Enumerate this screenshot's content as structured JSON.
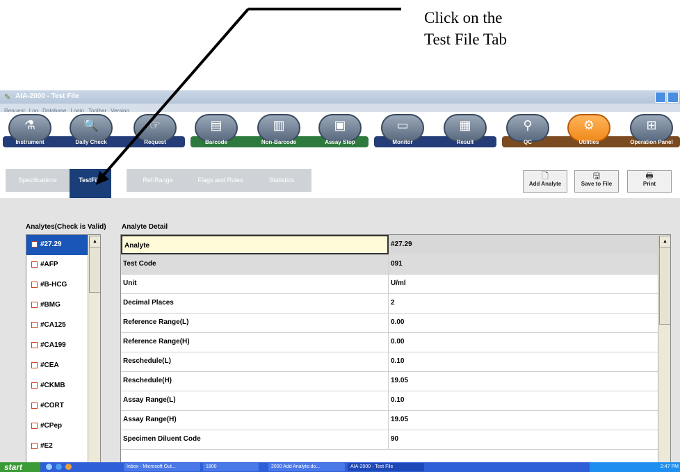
{
  "annotation": {
    "line1": "Click on the",
    "line2": "Test File Tab"
  },
  "window": {
    "title": "AIA-2000 - Test File"
  },
  "menu": [
    "Request",
    "Log",
    "Database",
    "Login",
    "Toolbar",
    "Version"
  ],
  "toolbar": [
    {
      "label": "Instrument",
      "icon": "instrument-icon",
      "glyph": "⚗"
    },
    {
      "label": "Daily Check",
      "icon": "magnifier-document-icon",
      "glyph": "🔍"
    },
    {
      "label": "Request",
      "icon": "request-icon",
      "glyph": "☞"
    },
    {
      "label": "Barcode",
      "icon": "barcode-icon",
      "glyph": "▤"
    },
    {
      "label": "Non-Barcode",
      "icon": "non-barcode-icon",
      "glyph": "▥"
    },
    {
      "label": "Assay Stop",
      "icon": "assay-stop-icon",
      "glyph": "▣"
    },
    {
      "label": "Monitor",
      "icon": "monitor-icon",
      "glyph": "▭"
    },
    {
      "label": "Result",
      "icon": "result-icon",
      "glyph": "▦"
    },
    {
      "label": "QC",
      "icon": "qc-icon",
      "glyph": "⚲"
    },
    {
      "label": "Utilities",
      "icon": "gears-icon",
      "glyph": "⚙"
    },
    {
      "label": "Operation Panel",
      "icon": "operation-panel-icon",
      "glyph": "⊞"
    }
  ],
  "tabs": [
    "Specifications",
    "TestFile",
    "Ref.Range",
    "Flags and Rules",
    "Statistics"
  ],
  "active_tab": "TestFile",
  "actions": [
    {
      "label": "Add Analyte",
      "icon": "document-icon",
      "glyph": "🗋"
    },
    {
      "label": "Save to File",
      "icon": "floppy-disk-icon",
      "glyph": "🖫"
    },
    {
      "label": "Print",
      "icon": "printer-icon",
      "glyph": "🖶"
    }
  ],
  "analytes_label": "Analytes(Check is Valid)",
  "detail_label": "Analyte Detail",
  "analytes": [
    "#27.29",
    "#AFP",
    "#B-HCG",
    "#BMG",
    "#CA125",
    "#CA199",
    "#CEA",
    "#CKMB",
    "#CORT",
    "#CPep",
    "#E2"
  ],
  "selected_analyte": "#27.29",
  "detail_rows": [
    {
      "field": "Analyte",
      "value": "#27.29"
    },
    {
      "field": "Test Code",
      "value": "091"
    },
    {
      "field": "Unit",
      "value": "U/ml"
    },
    {
      "field": "Decimal Places",
      "value": "2"
    },
    {
      "field": "Reference Range(L)",
      "value": "0.00"
    },
    {
      "field": "Reference Range(H)",
      "value": "0.00"
    },
    {
      "field": "Reschedule(L)",
      "value": "0.10"
    },
    {
      "field": "Reschedule(H)",
      "value": "19.05"
    },
    {
      "field": "Assay Range(L)",
      "value": "0.10"
    },
    {
      "field": "Assay Range(H)",
      "value": "19.05"
    },
    {
      "field": "Specimen Diluent Code",
      "value": "90"
    }
  ],
  "taskbar": {
    "start": "start",
    "tasks": [
      "Inbox - Microsoft Out...",
      "1800",
      "2000 Add Analyte.do...",
      "AIA-2000 - Test File"
    ],
    "clock": "2:47 PM"
  },
  "colors": {
    "active_tab": "#1a3e78",
    "selected_row": "#1a56b8",
    "utilities": "#f08a1c",
    "band_blue": "#243c78",
    "band_green": "#2e7a3e",
    "band_brown": "#7a4a20"
  }
}
